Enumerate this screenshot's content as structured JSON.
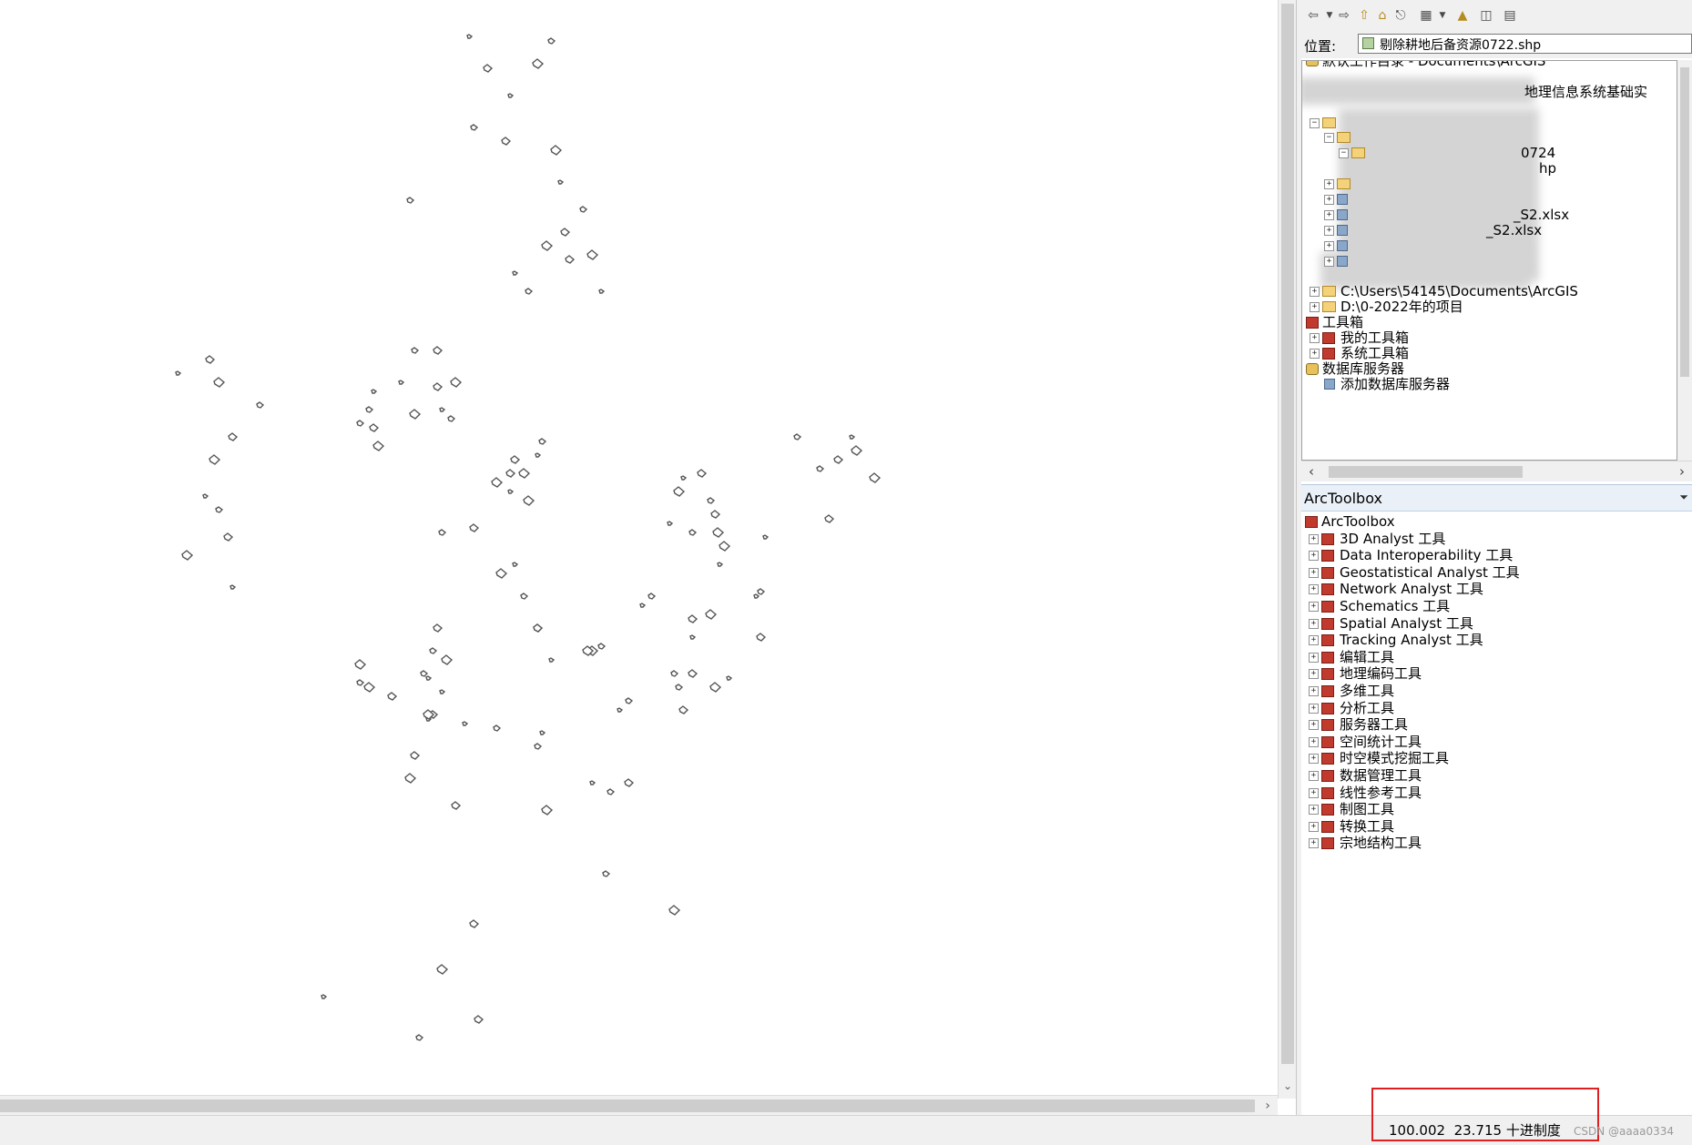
{
  "catalog": {
    "location_label": "位置:",
    "location_value": "剔除耕地后备资源0722.shp",
    "toolbar_icons": [
      "back-icon",
      "dropdown-icon",
      "forward-icon",
      "up-level-icon",
      "home-icon",
      "disconnect-icon",
      "view-options-icon",
      "dropdown-icon",
      "connect-folder-icon",
      "toggle-tree-icon",
      "options-icon"
    ],
    "tree": {
      "root": "默认工作目录 - Documents\\ArcGIS",
      "partial_items": [
        {
          "label": "地理信息系统基础实"
        },
        {
          "label": "0724"
        },
        {
          "label": "hp"
        },
        {
          "label": "_S2.xlsx"
        },
        {
          "label": "_S2.xlsx"
        }
      ],
      "folder_connections": [
        {
          "label": "C:\\Users\\54145\\Documents\\ArcGIS"
        },
        {
          "label": "D:\\0-2022年的项目"
        }
      ],
      "toolboxes": {
        "label": "工具箱",
        "children": [
          {
            "label": "我的工具箱"
          },
          {
            "label": "系统工具箱"
          }
        ]
      },
      "database_servers": {
        "label": "数据库服务器",
        "children": [
          {
            "label": "添加数据库服务器"
          }
        ]
      }
    }
  },
  "arctoolbox": {
    "title": "ArcToolbox",
    "root": "ArcToolbox",
    "items": [
      {
        "label": "3D Analyst 工具"
      },
      {
        "label": "Data Interoperability 工具"
      },
      {
        "label": "Geostatistical Analyst 工具"
      },
      {
        "label": "Network Analyst 工具"
      },
      {
        "label": "Schematics 工具"
      },
      {
        "label": "Spatial Analyst 工具"
      },
      {
        "label": "Tracking Analyst 工具"
      },
      {
        "label": "编辑工具"
      },
      {
        "label": "地理编码工具"
      },
      {
        "label": "多维工具"
      },
      {
        "label": "分析工具"
      },
      {
        "label": "服务器工具"
      },
      {
        "label": "空间统计工具"
      },
      {
        "label": "时空模式挖掘工具"
      },
      {
        "label": "数据管理工具"
      },
      {
        "label": "线性参考工具"
      },
      {
        "label": "制图工具"
      },
      {
        "label": "转换工具"
      },
      {
        "label": "宗地结构工具"
      }
    ]
  },
  "status": {
    "coordinates": "100.002  23.715 十进制度"
  },
  "watermark": "CSDN @aaaa0334",
  "colors": {
    "highlight_box": "#e02020",
    "map_feature": "#555555",
    "panel_bg": "#f0f0f0",
    "toolbox_title_bg": "#eaf0f8"
  }
}
